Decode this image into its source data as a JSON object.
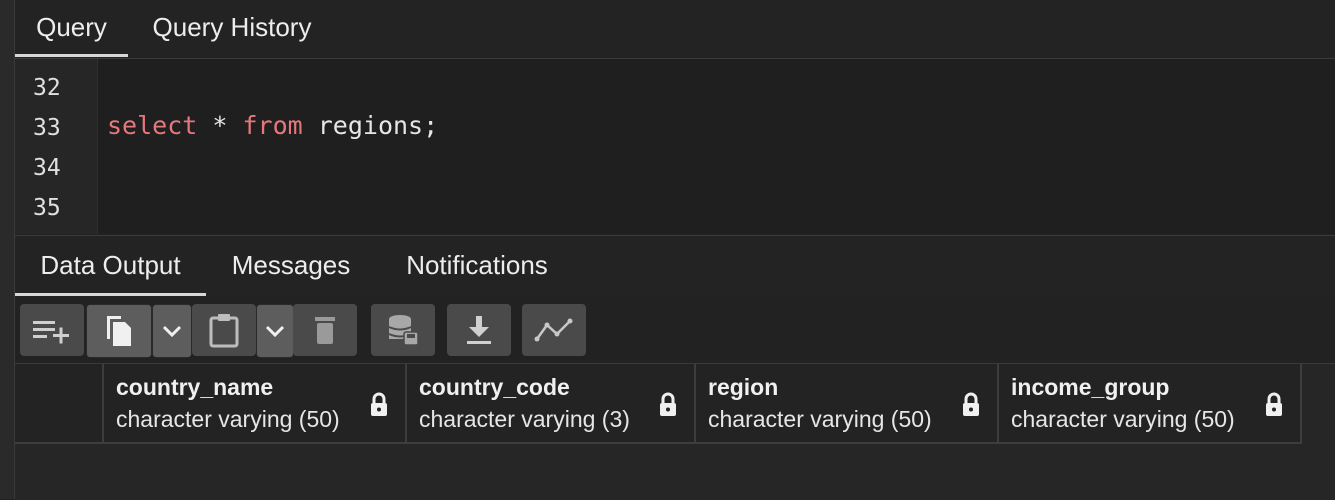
{
  "query_tabs": [
    {
      "label": "Query",
      "active": true
    },
    {
      "label": "Query History",
      "active": false
    }
  ],
  "editor": {
    "line_numbers": [
      "32",
      "33",
      "34",
      "35"
    ],
    "code": {
      "kw1": "select",
      "star": " * ",
      "kw2": "from",
      "rest": " regions;"
    }
  },
  "output_tabs": [
    {
      "label": "Data Output",
      "active": true
    },
    {
      "label": "Messages",
      "active": false
    },
    {
      "label": "Notifications",
      "active": false
    }
  ],
  "toolbar": {
    "buttons": [
      "add-row-icon",
      "copy-icon",
      "chevron-down-icon",
      "paste-icon",
      "chevron-down-icon",
      "delete-icon",
      "save-data-icon",
      "download-icon",
      "graph-icon"
    ]
  },
  "columns": [
    {
      "name": "country_name",
      "type": "character varying (50)"
    },
    {
      "name": "country_code",
      "type": "character varying (3)"
    },
    {
      "name": "region",
      "type": "character varying (50)"
    },
    {
      "name": "income_group",
      "type": "character varying (50)"
    }
  ],
  "colors": {
    "keyword": "#e4787c",
    "background": "#222222"
  }
}
